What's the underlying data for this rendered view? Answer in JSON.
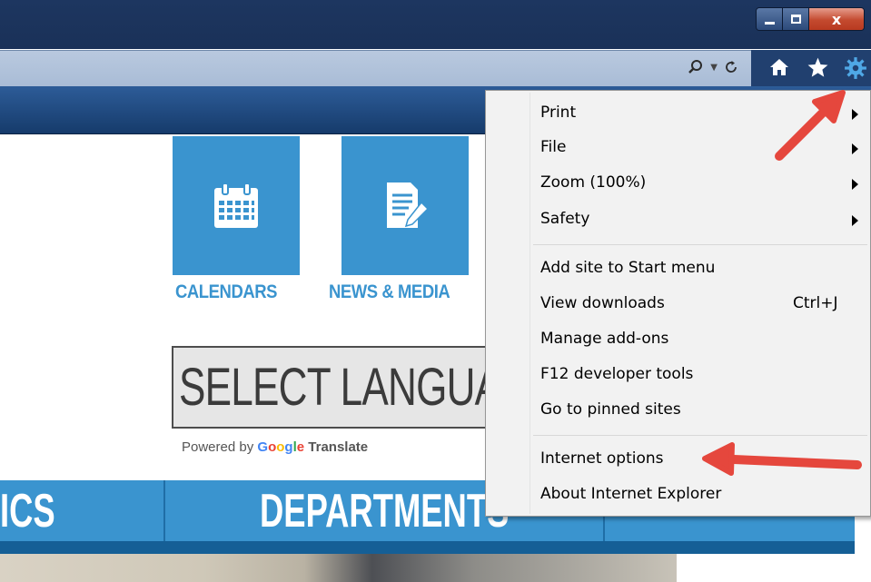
{
  "window": {
    "minimize_icon": "minimize-icon",
    "maximize_icon": "restore-icon",
    "close_label": "x"
  },
  "addressbar": {
    "search_icon": "search-icon",
    "refresh_icon": "refresh-icon"
  },
  "toolbar": {
    "home_icon": "home-icon",
    "favorites_icon": "star-icon",
    "tools_icon": "gear-icon"
  },
  "page": {
    "tiles": [
      {
        "label": "CALENDARS",
        "icon": "calendar-icon"
      },
      {
        "label": "NEWS & MEDIA",
        "icon": "document-pen-icon"
      }
    ],
    "language_select": "SELECT LANGUAG",
    "powered_by": "Powered by",
    "google": "Google",
    "translate": "Translate",
    "nav": [
      "ICS",
      "DEPARTMENTS"
    ]
  },
  "menu": {
    "items": [
      {
        "label": "Print",
        "submenu": true
      },
      {
        "label": "File",
        "submenu": true
      },
      {
        "label": "Zoom (100%)",
        "submenu": true
      },
      {
        "label": "Safety",
        "submenu": true
      },
      {
        "label": "Add site to Start menu"
      },
      {
        "label": "View downloads",
        "shortcut": "Ctrl+J"
      },
      {
        "label": "Manage add-ons"
      },
      {
        "label": "F12 developer tools"
      },
      {
        "label": "Go to pinned sites"
      },
      {
        "label": "Internet options"
      },
      {
        "label": "About Internet Explorer"
      }
    ]
  },
  "colors": {
    "tile_blue": "#3a94cf",
    "arrow_red": "#e5473d",
    "chrome_navy": "#1d3660"
  }
}
